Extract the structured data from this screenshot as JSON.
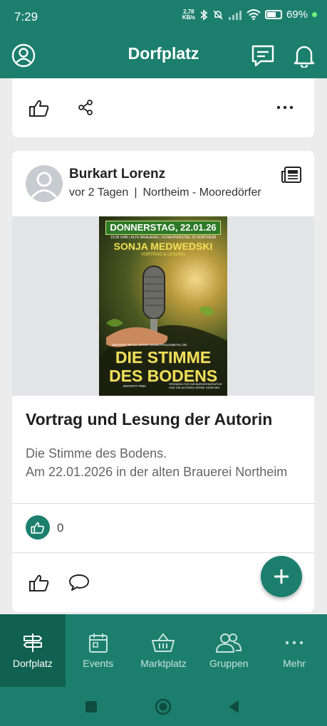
{
  "status": {
    "time": "7:29",
    "speed_value": "2,78",
    "speed_unit": "KB/s",
    "battery": "69%"
  },
  "appbar": {
    "title": "Dorfplatz"
  },
  "post": {
    "author": "Burkart Lorenz",
    "time_ago": "vor 2 Tagen",
    "separator": "|",
    "location": "Northeim - Mooredörfer",
    "title": "Vortrag und Lesung der Autorin",
    "body_line1": "Die Stimme des Bodens.",
    "body_line2": "Am 22.01.2026 in der alten Brauerei Northeim",
    "like_count": "0"
  },
  "poster": {
    "date": "DONNERSTAG, 22.01.26",
    "venue": "19:30 UHR | ALTE BRAUEREI | SCHAUPENSTIEL 20 NORTHEIM",
    "speaker": "SONJA MEDWEDSKI",
    "subtitle": "VORTRAG & LESUNG",
    "info": "WEITERE INFOS UNTER WWW.PROLEINETAL.DE",
    "headline1": "DIE STIMME",
    "headline2": "DES BODENS",
    "free": "EINTRITT FREI",
    "donation1": "SPENDEN FÜR DIE BÜRGERINITIATIVE",
    "donation2": "UND DIE AUTORIN GERNE GESEHEN."
  },
  "nav": [
    {
      "label": "Dorfplatz",
      "icon": "signpost-icon"
    },
    {
      "label": "Events",
      "icon": "calendar-icon"
    },
    {
      "label": "Marktplatz",
      "icon": "basket-icon"
    },
    {
      "label": "Gruppen",
      "icon": "group-icon"
    },
    {
      "label": "Mehr",
      "icon": "more-icon"
    }
  ],
  "colors": {
    "primary": "#1c7f6e",
    "active_nav": "#10614f"
  }
}
